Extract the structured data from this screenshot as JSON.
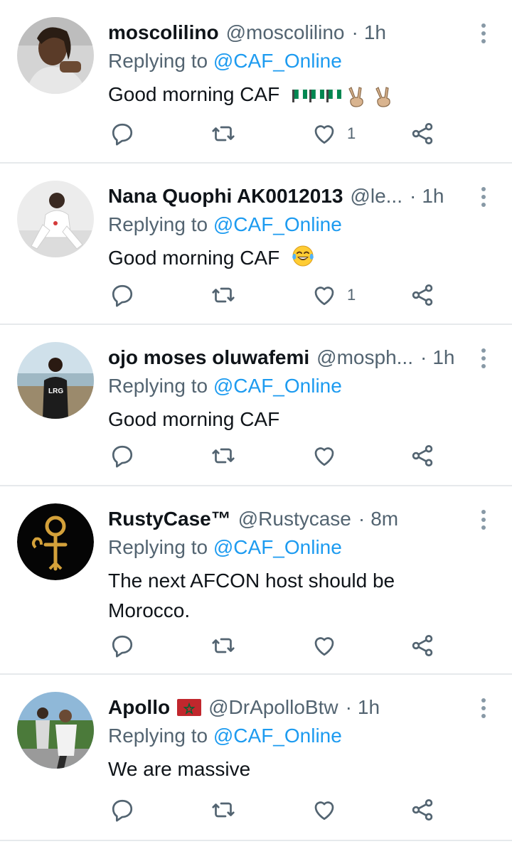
{
  "tweets": [
    {
      "name": "moscolilino",
      "handle": "@moscolilino",
      "sep": "·",
      "time": "1h",
      "reply_prefix": "Replying to ",
      "reply_to": "@CAF_Online",
      "text": "Good morning CAF",
      "text_emojis": [
        "flag-nigeria",
        "flag-nigeria",
        "flag-nigeria",
        "victory-hand",
        "victory-hand"
      ],
      "likes": "1",
      "avatar_colors": [
        "#cfcfcf",
        "#5a3b28",
        "#d8d8d8"
      ]
    },
    {
      "name": "Nana Quophi AK0012013",
      "handle": "@le...",
      "sep": "·",
      "time": "1h",
      "reply_prefix": "Replying to ",
      "reply_to": "@CAF_Online",
      "text": "Good morning CAF",
      "text_emojis": [
        "tears-of-joy"
      ],
      "likes": "1",
      "avatar_colors": [
        "#e9e9e9",
        "#3a2a22",
        "#ffffff"
      ]
    },
    {
      "name": "ojo moses oluwafemi",
      "handle": "@mosph...",
      "sep": "·",
      "time": "1h",
      "reply_prefix": "Replying to ",
      "reply_to": "@CAF_Online",
      "text": "Good morning CAF",
      "text_emojis": [],
      "likes": "",
      "avatar_colors": [
        "#cfe0ea",
        "#7a6a55",
        "#1c1c1c"
      ]
    },
    {
      "name": "RustyCase™",
      "handle": "@Rustycase",
      "sep": "·",
      "time": "8m",
      "reply_prefix": "Replying to ",
      "reply_to": "@CAF_Online",
      "text": "The next AFCON host should be Morocco.",
      "text_emojis": [],
      "likes": "",
      "avatar_colors": [
        "#050505",
        "#d4a13a",
        "#d4a13a"
      ]
    },
    {
      "name": "Apollo",
      "name_flag": "flag-morocco",
      "handle": "@DrApolloBtw",
      "sep": "·",
      "time": "1h",
      "reply_prefix": "Replying to ",
      "reply_to": "@CAF_Online",
      "text": "We are massive",
      "text_emojis": [],
      "likes": "",
      "avatar_colors": [
        "#8fb8d8",
        "#4b7a3a",
        "#d9d9d9"
      ]
    }
  ],
  "icons": {
    "reply": "reply-icon",
    "retweet": "retweet-icon",
    "like": "like-icon",
    "share": "share-icon",
    "more": "more-vertical-icon"
  },
  "colors": {
    "text": "#0f1419",
    "muted": "#536471",
    "link": "#1d9bf0",
    "divider": "#e6e9ec"
  }
}
